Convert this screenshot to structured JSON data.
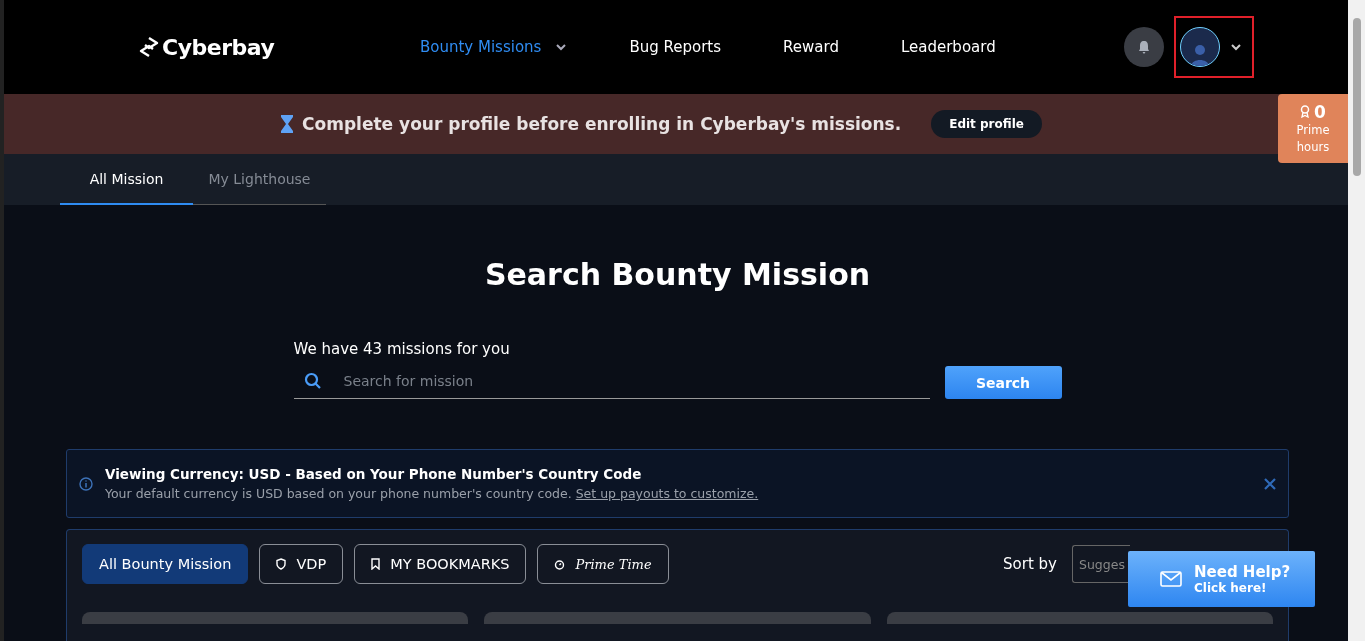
{
  "nav": {
    "logo": "Cyberbay",
    "links": [
      {
        "label": "Bounty Missions",
        "selected": true,
        "dropdown": true
      },
      {
        "label": "Bug Reports",
        "selected": false,
        "dropdown": false
      },
      {
        "label": "Reward",
        "selected": false,
        "dropdown": false
      },
      {
        "label": "Leaderboard",
        "selected": false,
        "dropdown": false
      }
    ]
  },
  "banner": {
    "text": "Complete your profile before enrolling in Cyberbay's missions.",
    "button": "Edit profile"
  },
  "prime": {
    "count": "0",
    "label": "Prime hours"
  },
  "tabs": [
    {
      "label": "All Mission",
      "selected": true
    },
    {
      "label": "My Lighthouse",
      "selected": false
    }
  ],
  "heading": "Search Bounty Mission",
  "count_text": "We have 43 missions for you",
  "search": {
    "placeholder": "Search for mission",
    "button": "Search"
  },
  "notice": {
    "title": "Viewing Currency: USD - Based on Your Phone Number's Country Code",
    "text": "Your default currency is USD based on your phone number's country code.",
    "link": "Set up payouts to customize."
  },
  "filters": [
    {
      "label": "All Bounty Mission",
      "selected": true,
      "kind": "plain"
    },
    {
      "label": "VDP",
      "selected": false,
      "kind": "shield"
    },
    {
      "label": "MY BOOKMARKS",
      "selected": false,
      "kind": "bookmark"
    },
    {
      "label": "Prime Time",
      "selected": false,
      "kind": "script"
    }
  ],
  "sort": {
    "label": "Sort by",
    "value": "Sugges"
  },
  "help": {
    "title": "Need Help?",
    "subtitle": "Click here!"
  }
}
